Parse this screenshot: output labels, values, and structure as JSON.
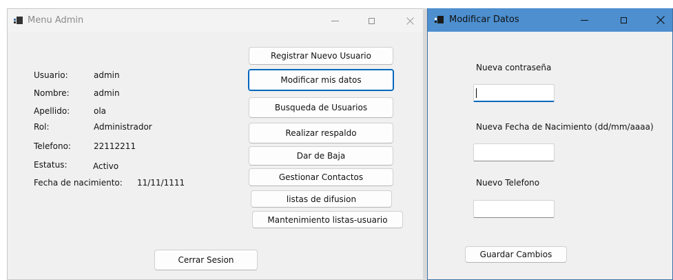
{
  "menu_admin": {
    "title": "Menu Admin",
    "fields": [
      {
        "label": "Usuario:",
        "value": "admin"
      },
      {
        "label": "Nombre:",
        "value": "admin"
      },
      {
        "label": "Apellido:",
        "value": "ola"
      },
      {
        "label": "Rol:",
        "value": "Administrador"
      },
      {
        "label": "Telefono:",
        "value": "22112211"
      },
      {
        "label": "Estatus:",
        "value": "Activo"
      },
      {
        "label": "Fecha de nacimiento:",
        "value": "11/11/1111"
      }
    ],
    "buttons": [
      "Registrar Nuevo Usuario",
      "Modificar mis datos",
      "Busqueda de Usuarios",
      "Realizar respaldo",
      "Dar de Baja",
      "Gestionar Contactos",
      "listas de difusion",
      "Mantenimiento listas-usuario"
    ],
    "logout": "Cerrar Sesion"
  },
  "modificar": {
    "title": "Modificar Datos",
    "password_label": "Nueva contraseña",
    "birthdate_label": "Nueva Fecha de Nacimiento (dd/mm/aaaa)",
    "phone_label": "Nuevo Telefono",
    "save": "Guardar Cambios"
  },
  "colors": {
    "active_titlebar": "#4d8fcf",
    "focus_accent": "#0067c0",
    "window_bg": "#f0f0f0"
  },
  "icons": [
    "app-icon",
    "minimize-icon",
    "maximize-icon",
    "close-icon"
  ]
}
